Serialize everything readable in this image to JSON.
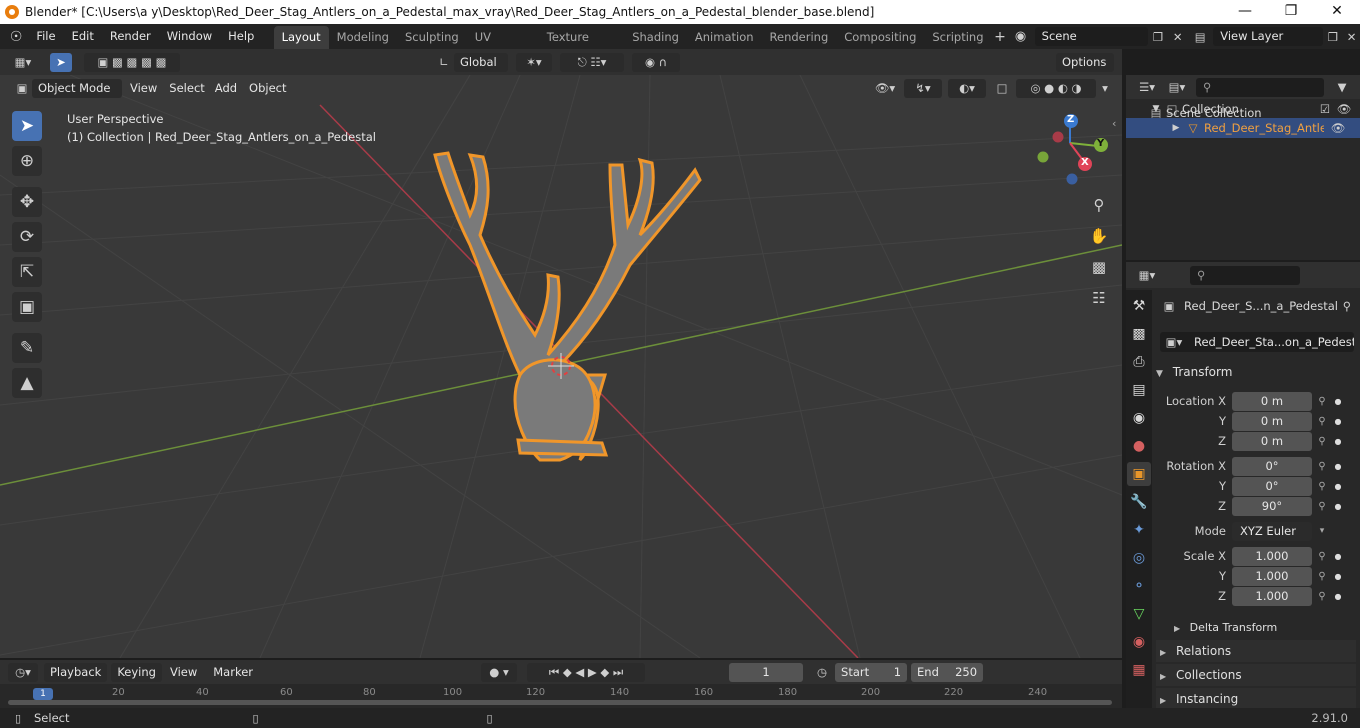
{
  "window": {
    "title": "Blender* [C:\\Users\\a y\\Desktop\\Red_Deer_Stag_Antlers_on_a_Pedestal_max_vray\\Red_Deer_Stag_Antlers_on_a_Pedestal_blender_base.blend]"
  },
  "menus": [
    "File",
    "Edit",
    "Render",
    "Window",
    "Help"
  ],
  "workspaces": [
    "Layout",
    "Modeling",
    "Sculpting",
    "UV Editing",
    "Texture Paint",
    "Shading",
    "Animation",
    "Rendering",
    "Compositing",
    "Scripting"
  ],
  "scene": "Scene",
  "view_layer": "View Layer",
  "toolbar": {
    "orientation": "Global",
    "options": "Options"
  },
  "viewport_header": {
    "mode": "Object Mode",
    "menus": [
      "View",
      "Select",
      "Add",
      "Object"
    ]
  },
  "viewport": {
    "perspective": "User Perspective",
    "collection_info": "(1) Collection | Red_Deer_Stag_Antlers_on_a_Pedestal"
  },
  "gizmo": {
    "x": "X",
    "y": "Y",
    "z": "Z"
  },
  "outliner": {
    "scene_collection": "Scene Collection",
    "collection": "Collection",
    "object": "Red_Deer_Stag_Antle"
  },
  "properties": {
    "object_name": "Red_Deer_S...n_a_Pedestal",
    "data_name": "Red_Deer_Sta...on_a_Pedestal",
    "transform_label": "Transform",
    "location": {
      "label": "Location X",
      "x": "0 m",
      "y": "0 m",
      "z": "0 m"
    },
    "rotation": {
      "label": "Rotation X",
      "x": "0°",
      "y": "0°",
      "z": "90°"
    },
    "mode_label": "Mode",
    "mode_value": "XYZ Euler",
    "scale": {
      "label": "Scale X",
      "x": "1.000",
      "y": "1.000",
      "z": "1.000"
    },
    "axis_y": "Y",
    "axis_z": "Z",
    "delta_transform": "Delta Transform",
    "relations": "Relations",
    "collections": "Collections",
    "instancing": "Instancing"
  },
  "timeline": {
    "menus": [
      "Playback",
      "Keying",
      "View",
      "Marker"
    ],
    "current_frame": "1",
    "start_label": "Start",
    "start_value": "1",
    "end_label": "End",
    "end_value": "250",
    "ticks": [
      "20",
      "40",
      "60",
      "80",
      "100",
      "120",
      "140",
      "160",
      "180",
      "200",
      "220",
      "240"
    ]
  },
  "status": {
    "select": "Select",
    "version": "2.91.0"
  },
  "colors": {
    "accent": "#4772b3",
    "selection": "#e8962a",
    "x_axis": "#e04458",
    "y_axis": "#7fb13a",
    "z_axis": "#3a7ad0"
  }
}
